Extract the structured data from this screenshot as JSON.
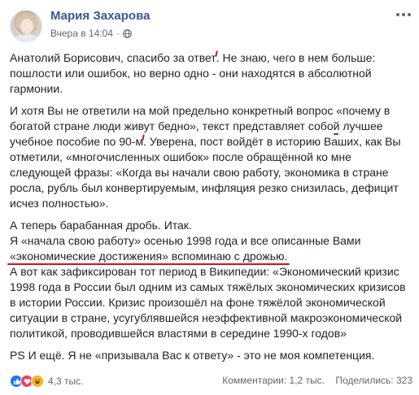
{
  "post": {
    "author": "Мария Захарова",
    "time": "Вчера в 14:04",
    "separator": "·",
    "privacy_icon": "globe-icon",
    "more_icon": "more-options-icon",
    "paragraphs": {
      "p1": {
        "a": "Анатолий Борисович, спасибо за ответ",
        "b": ". Не знаю, чего в нем больше: пошлости или ошибок, но верно одно - они находятся в абсолютной гармонии."
      },
      "p2": {
        "a": "И хотя Вы не ответили на мой предельно конкретный вопрос ",
        "u1": "«почему в богатой стране люди живут бедно»",
        "b": ", текст представляет собой лучшее учебное пособие по 90-м",
        "c": ". Уверена, пост войдёт в историю Ваших, как Вы отметили, «многочисленных ошибок» после обращённой ко мне следующей фразы: «Когда вы начали свою работу, экономика в стране росла, рубль был конвертируемым, инфляция резко снизилась, дефицит исчез полностью»."
      },
      "p3": {
        "a": "А теперь барабанная дробь. Итак.",
        "u1": "Я «начала свою работу» осенью 1998 года и все описанные Вами «экономические достижения» вспоминаю с дрожью.",
        "b": "А вот как зафиксирован тот период в Википедии: «Экономический кризис 1998 года в России был одним из самых тяжёлых экономических кризисов в истории России. Кризис произошёл на фоне тяжёлой экономической ситуации в стране, усугублявшейся неэффективной макроэкономической политикой, проводившейся властями в середине 1990-х годов»"
      },
      "p4": "PS И ещё. Я не «призывала Вас к ответу» - это не моя компетенция."
    },
    "annotation_color": "#d80f1b"
  },
  "footer": {
    "reaction_icons": [
      "like-icon",
      "love-icon",
      "haha-icon"
    ],
    "reaction_count": "4,3 тыс.",
    "comments": "Комментарии: 1,2 тыс.",
    "shares": "Поделились: 323"
  },
  "colors": {
    "author": "#385898",
    "meta": "#616770",
    "like": "#1877f2",
    "love": "#f33e58",
    "haha": "#f7b125"
  }
}
